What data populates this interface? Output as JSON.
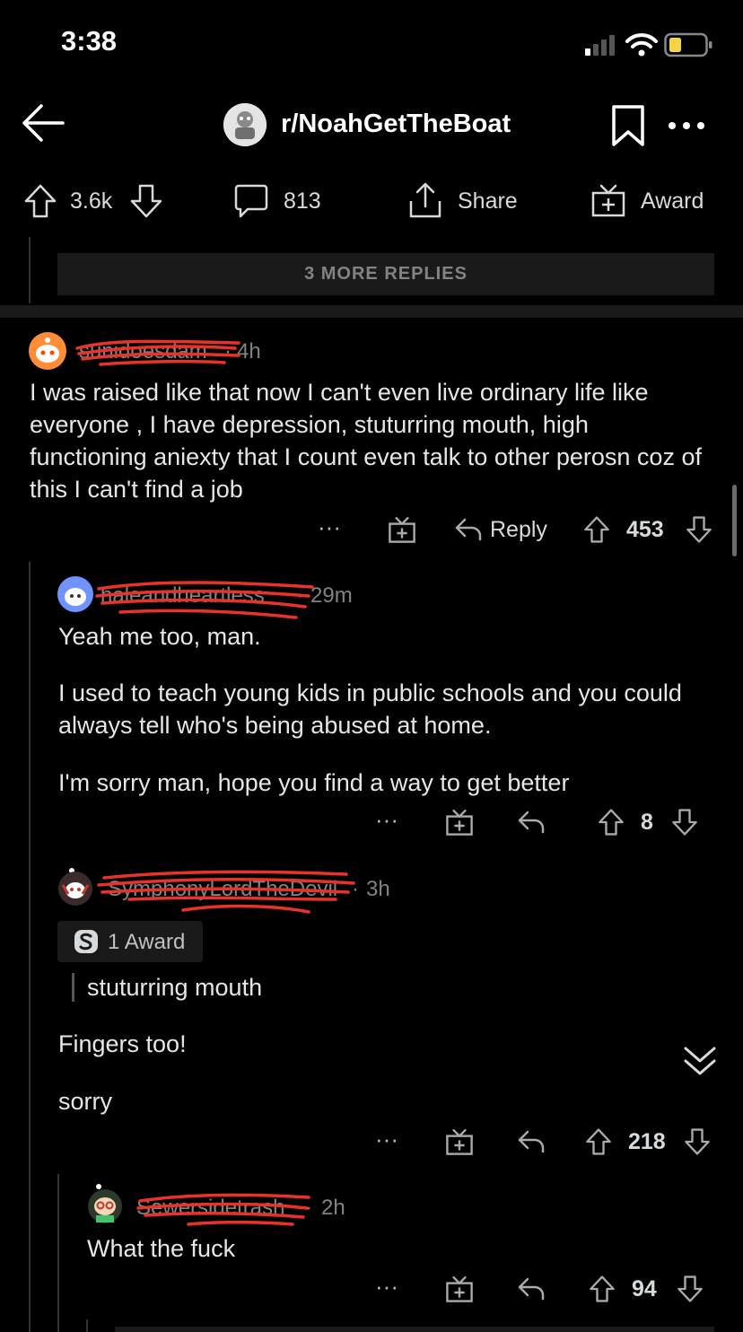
{
  "status": {
    "time": "3:38"
  },
  "header": {
    "subreddit": "r/NoahGetTheBoat"
  },
  "post_actions": {
    "upvotes": "3.6k",
    "comments": "813",
    "share": "Share",
    "award": "Award"
  },
  "more_replies": "3 MORE REPLIES",
  "comments": [
    {
      "username": "sunidoesdam",
      "time": "4h",
      "body": "I was raised like that now I can't even live ordinary life like everyone , I have depression, stuturring mouth, high functioning aniexty that I count even talk to other perosn coz of this I can't find a job",
      "reply_label": "Reply",
      "score": "453"
    },
    {
      "username": "haleandheartless",
      "time": "29m",
      "paragraphs": [
        "Yeah me too, man.",
        "I used to teach young kids in public schools and you could always tell who's being abused at home.",
        "I'm sorry man, hope you find a way to get better"
      ],
      "score": "8"
    },
    {
      "username": "SymphonyLordTheDevil",
      "time": "3h",
      "award": "1 Award",
      "quote": "stuturring mouth",
      "paragraphs": [
        "Fingers too!",
        "sorry"
      ],
      "score": "218"
    },
    {
      "username": "Sewersidetrash",
      "time": "2h",
      "body": "What the fuck",
      "score": "94"
    }
  ],
  "icons": [
    "back-arrow-icon",
    "bookmark-icon",
    "more-icon",
    "upvote-icon",
    "downvote-icon",
    "comment-icon",
    "share-icon",
    "award-icon",
    "reply-icon",
    "collapse-chevron-icon",
    "wifi-icon",
    "battery-icon",
    "signal-icon"
  ],
  "colors": {
    "background": "#000000",
    "text": "#d7dadc",
    "meta": "#818384",
    "redact": "#e8332a",
    "battery": "#f5d547"
  }
}
